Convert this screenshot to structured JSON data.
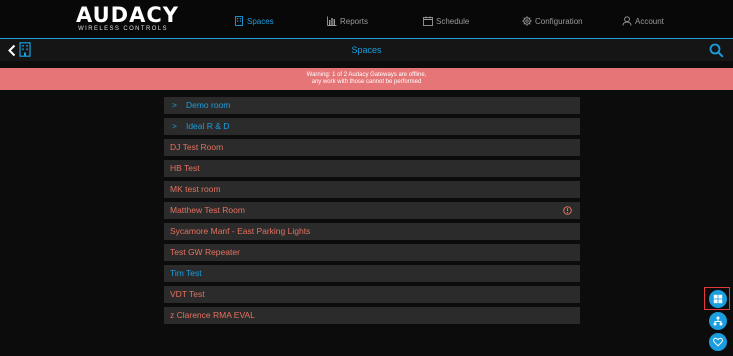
{
  "brand": {
    "name": "AUDACY",
    "tagline": "WIRELESS CONTROLS"
  },
  "nav": {
    "items": [
      {
        "label": "Spaces",
        "icon": "building-icon",
        "active": true
      },
      {
        "label": "Reports",
        "icon": "bar-chart-icon",
        "active": false
      },
      {
        "label": "Schedule",
        "icon": "calendar-icon",
        "active": false
      },
      {
        "label": "Configuration",
        "icon": "gear-icon",
        "active": false
      },
      {
        "label": "Account",
        "icon": "user-icon",
        "active": false
      }
    ]
  },
  "header": {
    "title": "Spaces"
  },
  "warning": {
    "line1": "Warning: 1 of 2 Audacy Gateways are offline,",
    "line2": "any work with those cannot be performed"
  },
  "spaces": [
    {
      "label": "Demo room",
      "type": "folder",
      "chevron": ">"
    },
    {
      "label": "Ideal R & D",
      "type": "folder",
      "chevron": ">"
    },
    {
      "label": "DJ Test Room",
      "type": "space",
      "status": "offline"
    },
    {
      "label": "HB Test",
      "type": "space",
      "status": "offline"
    },
    {
      "label": "MK test room",
      "type": "space",
      "status": "offline"
    },
    {
      "label": "Matthew Test Room",
      "type": "space",
      "status": "offline",
      "alert": true
    },
    {
      "label": "Sycamore Manf - East Parking Lights",
      "type": "space",
      "status": "offline"
    },
    {
      "label": "Test GW Repeater",
      "type": "space",
      "status": "offline"
    },
    {
      "label": "Tim Test",
      "type": "space",
      "status": "online"
    },
    {
      "label": "VDT Test",
      "type": "space",
      "status": "offline"
    },
    {
      "label": "z Clarence RMA EVAL",
      "type": "space",
      "status": "offline"
    }
  ],
  "fabs": [
    {
      "icon": "dashboard-icon"
    },
    {
      "icon": "network-icon"
    },
    {
      "icon": "heart-icon"
    }
  ],
  "colors": {
    "accent": "#1a9ee0",
    "warning": "#e57576",
    "offline_text": "#e5715f",
    "row_bg": "#2b2b2b"
  }
}
